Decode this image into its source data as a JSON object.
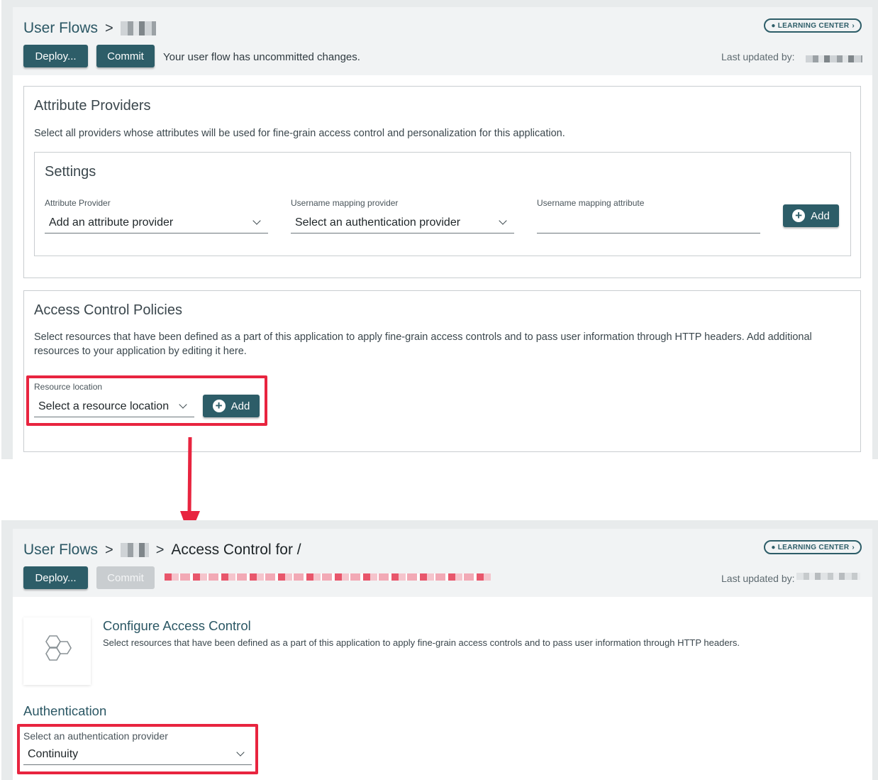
{
  "top": {
    "breadcrumb": {
      "root": "User Flows",
      "sep": ">"
    },
    "learning_center": "LEARNING CENTER",
    "deploy_label": "Deploy...",
    "commit_label": "Commit",
    "uncommitted_msg": "Your user flow has uncommitted changes.",
    "last_updated_label": "Last updated by:",
    "attribute_providers": {
      "title": "Attribute Providers",
      "description": "Select all providers whose attributes will be used for fine-grain access control and personalization for this application.",
      "settings": {
        "title": "Settings",
        "attr_provider_label": "Attribute Provider",
        "attr_provider_value": "Add an attribute provider",
        "username_provider_label": "Username mapping provider",
        "username_provider_value": "Select an authentication provider",
        "username_attr_label": "Username mapping attribute",
        "add_label": "Add"
      }
    },
    "access_control": {
      "title": "Access Control Policies",
      "description": "Select resources that have been defined as a part of this application to apply fine-grain access controls and to pass user information through HTTP headers. Add additional resources to your application by editing it here.",
      "resource_label": "Resource location",
      "resource_value": "Select a resource location",
      "add_label": "Add"
    }
  },
  "bottom": {
    "breadcrumb": {
      "root": "User Flows",
      "sep": ">",
      "current": "Access Control for /"
    },
    "learning_center": "LEARNING CENTER",
    "deploy_label": "Deploy...",
    "commit_label": "Commit",
    "last_updated_label": "Last updated by:",
    "configure": {
      "title": "Configure Access Control",
      "description": "Select resources that have been defined as a part of this application to apply fine-grain access controls and to pass user information through HTTP headers."
    },
    "authentication": {
      "title": "Authentication",
      "provider_label": "Select an authentication provider",
      "provider_value": "Continuity"
    }
  },
  "colors": {
    "accent": "#2d5d68",
    "highlight": "#e8243f",
    "background": "#e8ebec"
  },
  "icons": [
    "chevron-right-icon",
    "chevron-down-icon",
    "plus-circle-icon",
    "lightbulb-icon",
    "hexagon-logo-icon",
    "arrow-down-icon"
  ]
}
